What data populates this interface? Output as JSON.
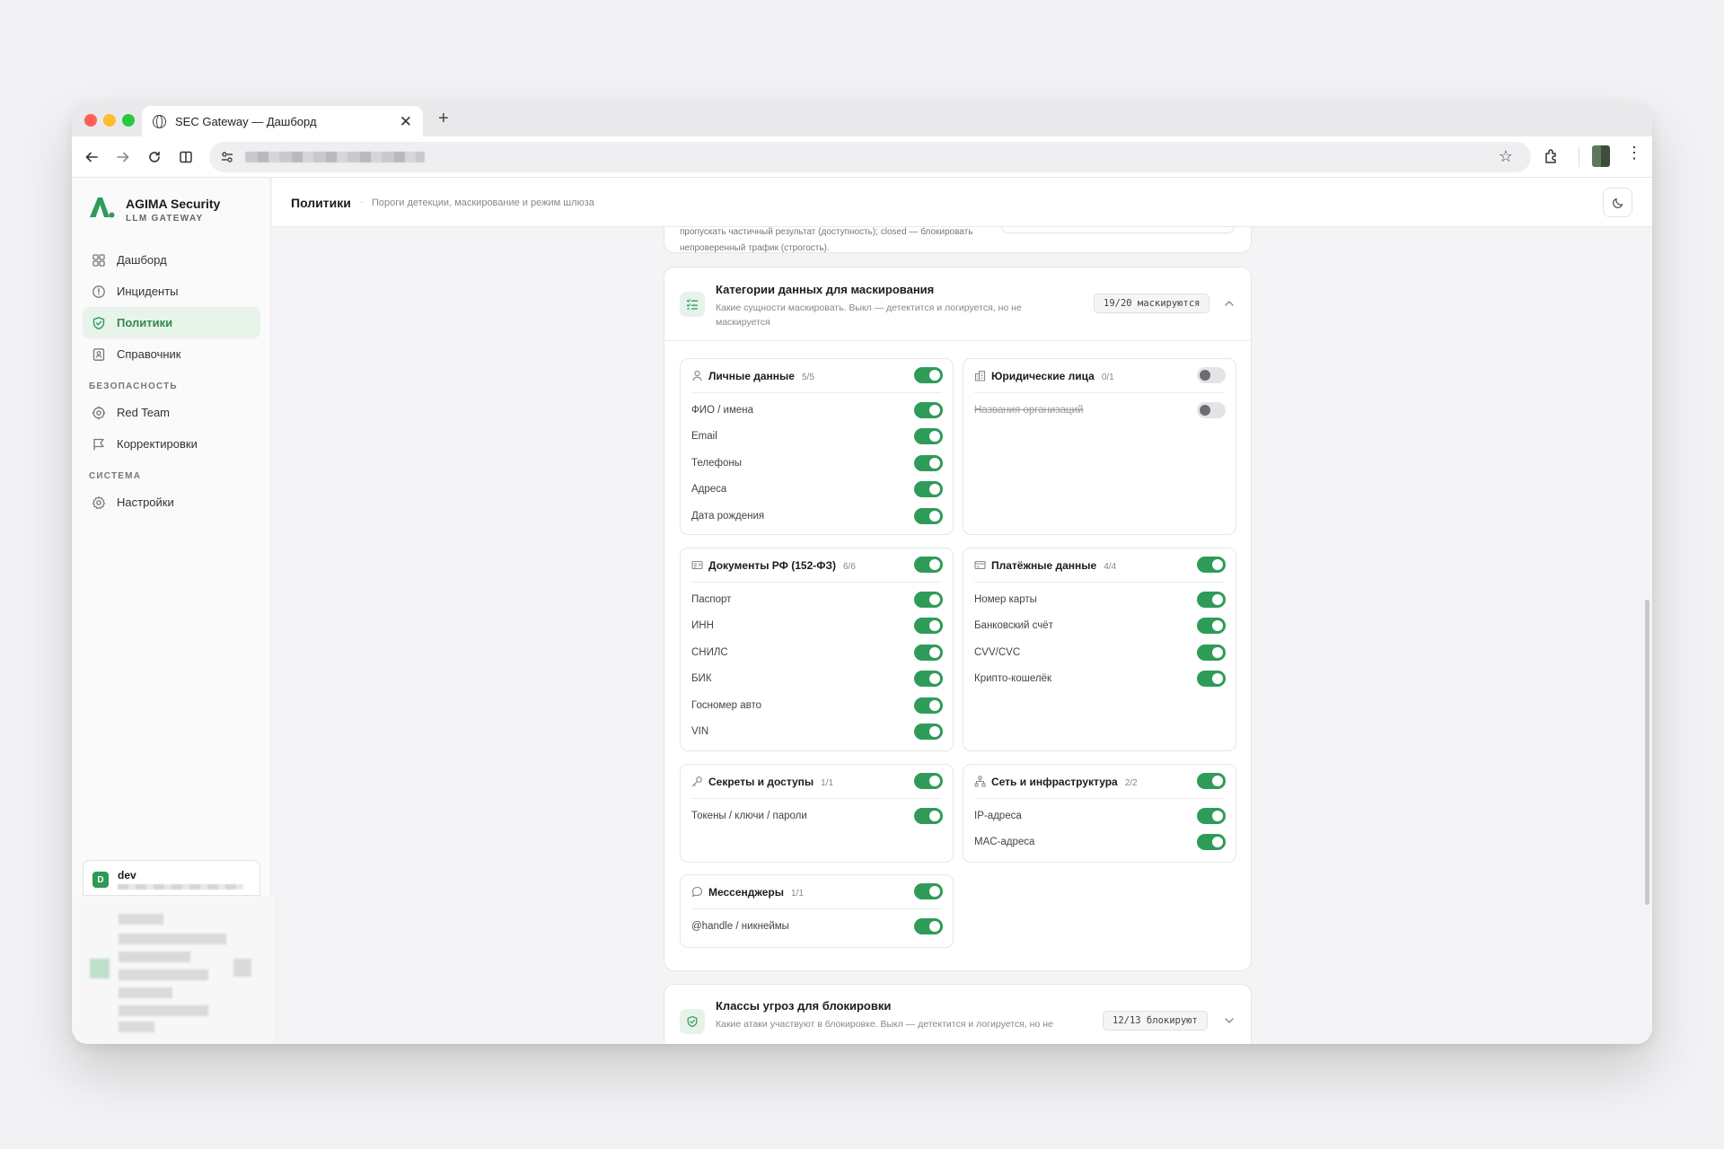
{
  "browser": {
    "tab_title": "SEC Gateway — Дашборд",
    "tab_close": "✕",
    "new_tab": "+"
  },
  "brand": {
    "name": "AGIMA Security",
    "subtitle": "LLM GATEWAY"
  },
  "sidebar": {
    "main_items": [
      {
        "label": "Дашборд",
        "icon": "grid-icon"
      },
      {
        "label": "Инциденты",
        "icon": "alert-circle-icon"
      },
      {
        "label": "Политики",
        "icon": "shield-check-icon",
        "active": true
      },
      {
        "label": "Справочник",
        "icon": "contact-book-icon"
      }
    ],
    "sections": [
      {
        "title": "БЕЗОПАСНОСТЬ",
        "items": [
          {
            "label": "Red Team",
            "icon": "crosshair-icon"
          },
          {
            "label": "Корректировки",
            "icon": "flag-icon"
          }
        ]
      },
      {
        "title": "СИСТЕМА",
        "items": [
          {
            "label": "Настройки",
            "icon": "gear-icon"
          }
        ]
      }
    ],
    "user": {
      "initial": "D",
      "name": "dev"
    }
  },
  "header": {
    "title": "Политики",
    "separator": "·",
    "subtitle": "Пороги детекции, маскирование и режим шлюза"
  },
  "prev_card": {
    "text": "пропускать частичный результат (доступность); closed — блокировать непроверенный трафик (строгость)."
  },
  "masking": {
    "title": "Категории данных для маскирования",
    "description": "Какие сущности маскировать. Выкл — детектится и логируется, но не маскируется",
    "badge": "19/20 маскируются",
    "groups": [
      {
        "title": "Личные данные",
        "count": "5/5",
        "icon": "user-icon",
        "enabled": true,
        "items": [
          {
            "label": "ФИО / имена",
            "on": true
          },
          {
            "label": "Email",
            "on": true
          },
          {
            "label": "Телефоны",
            "on": true
          },
          {
            "label": "Адреса",
            "on": true
          },
          {
            "label": "Дата рождения",
            "on": true
          }
        ]
      },
      {
        "title": "Юридические лица",
        "count": "0/1",
        "icon": "building-icon",
        "enabled": false,
        "items": [
          {
            "label": "Названия организаций",
            "on": false
          }
        ]
      },
      {
        "title": "Документы РФ (152-ФЗ)",
        "count": "6/6",
        "icon": "id-card-icon",
        "enabled": true,
        "items": [
          {
            "label": "Паспорт",
            "on": true
          },
          {
            "label": "ИНН",
            "on": true
          },
          {
            "label": "СНИЛС",
            "on": true
          },
          {
            "label": "БИК",
            "on": true
          },
          {
            "label": "Госномер авто",
            "on": true
          },
          {
            "label": "VIN",
            "on": true
          }
        ]
      },
      {
        "title": "Платёжные данные",
        "count": "4/4",
        "icon": "credit-card-icon",
        "enabled": true,
        "items": [
          {
            "label": "Номер карты",
            "on": true
          },
          {
            "label": "Банковский счёт",
            "on": true
          },
          {
            "label": "CVV/CVC",
            "on": true
          },
          {
            "label": "Крипто-кошелёк",
            "on": true
          }
        ]
      },
      {
        "title": "Секреты и доступы",
        "count": "1/1",
        "icon": "key-icon",
        "enabled": true,
        "items": [
          {
            "label": "Токены / ключи / пароли",
            "on": true
          }
        ]
      },
      {
        "title": "Сеть и инфраструктура",
        "count": "2/2",
        "icon": "network-icon",
        "enabled": true,
        "items": [
          {
            "label": "IP-адреса",
            "on": true
          },
          {
            "label": "MAC-адреса",
            "on": true
          }
        ]
      },
      {
        "title": "Мессенджеры",
        "count": "1/1",
        "icon": "chat-bubble-icon",
        "enabled": true,
        "items": [
          {
            "label": "@handle / никнеймы",
            "on": true
          }
        ]
      }
    ]
  },
  "threats": {
    "title": "Классы угроз для блокировки",
    "description": "Какие атаки участвуют в блокировке. Выкл — детектится и логируется, но не",
    "badge": "12/13 блокируют"
  },
  "colors": {
    "accent": "#2f9b58",
    "accent_bg": "#e8f3ea",
    "toggle_off": "#e4e4e6"
  }
}
